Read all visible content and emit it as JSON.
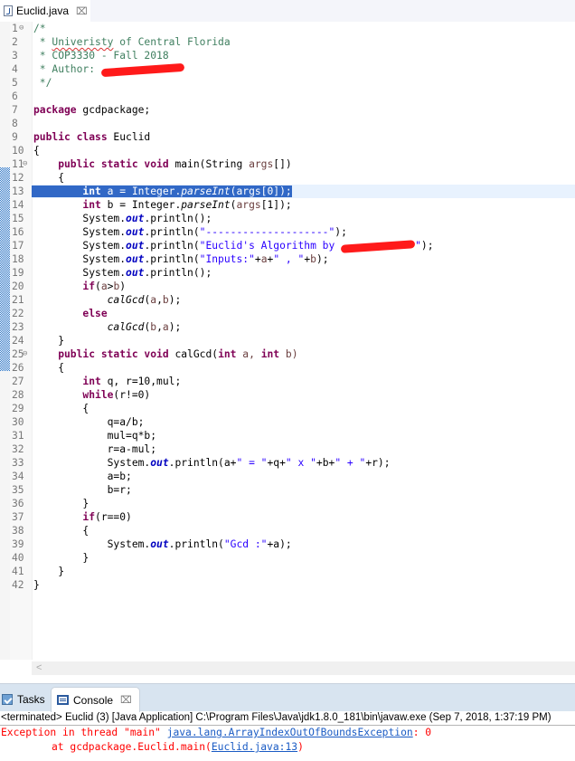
{
  "editor": {
    "tab_label": "Euclid.java",
    "tab_close": "⌧",
    "file_icon": "java-file-icon",
    "fold_glyph": "⊖",
    "lines": [
      {
        "n": "1"
      },
      {
        "n": "2"
      },
      {
        "n": "3"
      },
      {
        "n": "4"
      },
      {
        "n": "5"
      },
      {
        "n": "6"
      },
      {
        "n": "7"
      },
      {
        "n": "8"
      },
      {
        "n": "9"
      },
      {
        "n": "10"
      },
      {
        "n": "11"
      },
      {
        "n": "12"
      },
      {
        "n": "13"
      },
      {
        "n": "14"
      },
      {
        "n": "15"
      },
      {
        "n": "16"
      },
      {
        "n": "17"
      },
      {
        "n": "18"
      },
      {
        "n": "19"
      },
      {
        "n": "20"
      },
      {
        "n": "21"
      },
      {
        "n": "22"
      },
      {
        "n": "23"
      },
      {
        "n": "24"
      },
      {
        "n": "25"
      },
      {
        "n": "26"
      },
      {
        "n": "27"
      },
      {
        "n": "28"
      },
      {
        "n": "29"
      },
      {
        "n": "30"
      },
      {
        "n": "31"
      },
      {
        "n": "32"
      },
      {
        "n": "33"
      },
      {
        "n": "34"
      },
      {
        "n": "35"
      },
      {
        "n": "36"
      },
      {
        "n": "37"
      },
      {
        "n": "38"
      },
      {
        "n": "39"
      },
      {
        "n": "40"
      },
      {
        "n": "41"
      },
      {
        "n": "42"
      }
    ],
    "code": {
      "l1": "/*",
      "l2a": " * ",
      "l2b": "Univeristy",
      "l2c": " of Central Florida",
      "l3": " * COP3330 - Fall 2018",
      "l4": " * Author: ",
      "l5": " */",
      "l7a": "package",
      "l7b": " gcdpackage;",
      "l9a": "public class",
      "l9b": " Euclid",
      "l10": "{",
      "l11a": "    public static void",
      "l11b": " main(String ",
      "l11c": "args",
      "l11d": "[])",
      "l12": "    {",
      "l13pre": "        ",
      "l13a": "int",
      "l13b": " a = Integer.",
      "l13c": "parseInt",
      "l13d": "(args[0]);",
      "l14a": "        int",
      "l14b": " b = Integer.",
      "l14c": "parseInt",
      "l14d": "(",
      "l14e": "args",
      "l14f": "[1]);",
      "sys": "        System.",
      "out": "out",
      "println": ".println(",
      "l15": ");",
      "l16s": "\"--------------------\"",
      "l16e": ");",
      "l17s": "\"Euclid's Algorithm by ",
      "l17s2": "\"",
      "l17e": ");",
      "l18s": "\"Inputs:\"",
      "l18b": "+",
      "l18c": "a",
      "l18d": "+",
      "l18e": "\" , \"",
      "l18f": "+",
      "l18g": "b",
      "l18h": ");",
      "l19": ");",
      "l20a": "        if",
      "l20b": "(",
      "l20c": "a",
      "l20d": ">",
      "l20e": "b",
      "l20f": ")",
      "l21a": "            ",
      "l21b": "calGcd",
      "l21c": "(",
      "l21d": "a",
      "l21e": ",",
      "l21f": "b",
      "l21g": ");",
      "l22": "        else",
      "l23a": "            ",
      "l23b": "calGcd",
      "l23c": "(",
      "l23d": "b",
      "l23e": ",",
      "l23f": "a",
      "l23g": ");",
      "l24": "    }",
      "l25a": "    public static void",
      "l25b": " calGcd(",
      "l25c": "int",
      "l25d": " a, ",
      "l25e": "int",
      "l25f": " b)",
      "l26": "    {",
      "l27a": "        int",
      "l27b": " q, r=10,mul;",
      "l28a": "        while",
      "l28b": "(r!=0)",
      "l29": "        {",
      "l30": "            q=a/b;",
      "l31": "            mul=q*b;",
      "l32": "            r=a-mul;",
      "l33pre": "            System.",
      "l33a": "a+",
      "l33b": "\" = \"",
      "l33c": "+q+",
      "l33d": "\" x \"",
      "l33e": "+b+",
      "l33f": "\" + \"",
      "l33g": "+r);",
      "l34": "            a=b;",
      "l35": "            b=r;",
      "l36": "        }",
      "l37a": "        if",
      "l37b": "(r==0)",
      "l38": "        {",
      "l39pre": "            System.",
      "l39s": "\"Gcd :\"",
      "l39e": "+a);",
      "l40": "        }",
      "l41": "    }",
      "l42": "}"
    },
    "hscroll_arrow": "<"
  },
  "console": {
    "tabs": [
      {
        "label": "Tasks",
        "icon": "tasks-icon"
      },
      {
        "label": "Console",
        "icon": "console-icon",
        "active": true
      }
    ],
    "close": "⌧",
    "status": "<terminated> Euclid (3) [Java Application] C:\\Program Files\\Java\\jdk1.8.0_181\\bin\\javaw.exe (Sep 7, 2018, 1:37:19 PM)",
    "output": {
      "line1_prefix": "Exception in thread \"main\" ",
      "line1_link": "java.lang.ArrayIndexOutOfBoundsException",
      "line1_suffix": ": 0",
      "line2_prefix": "\tat gcdpackage.Euclid.main(",
      "line2_link": "Euclid.java:13",
      "line2_suffix": ")"
    }
  },
  "colors": {
    "keyword": "#7f0055",
    "comment": "#3f7f5f",
    "string": "#2a00ff",
    "field": "#0000c0",
    "selection": "#3168c6",
    "current_line": "#e8f2fe",
    "error": "#ff0000",
    "link": "#1a5bc4"
  }
}
